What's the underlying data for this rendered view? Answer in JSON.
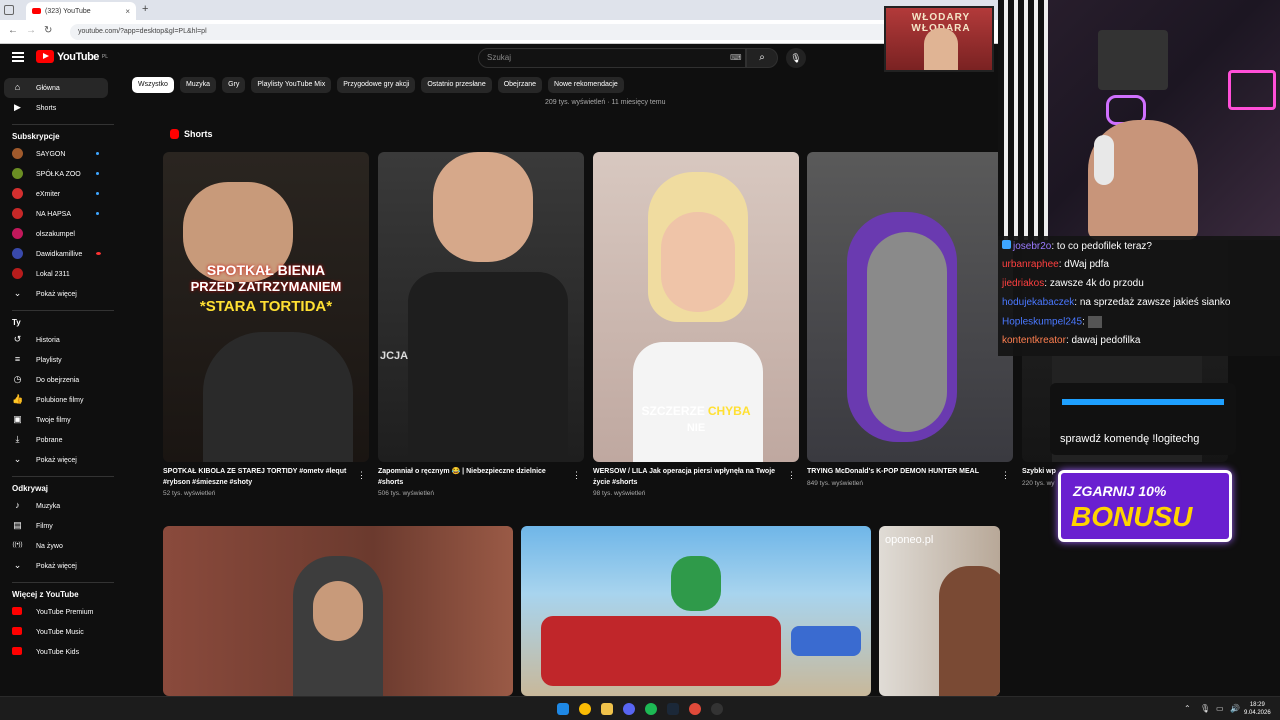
{
  "browser": {
    "tab_title": "(323) YouTube",
    "url": "youtube.com/?app=desktop&gl=PL&hl=pl",
    "new_tab": "+",
    "close": "×"
  },
  "youtube": {
    "logo_text": "YouTube",
    "logo_region": "PL",
    "search_placeholder": "Szukaj",
    "chips": [
      "Wszystko",
      "Muzyka",
      "Gry",
      "Playlisty YouTube Mix",
      "Przygodowe gry akcji",
      "Ostatnio przesłane",
      "Obejrzane",
      "Nowe rekomendacje"
    ],
    "views_line": "209 tys. wyświetleń · 11 miesięcy temu",
    "shorts_heading": "Shorts"
  },
  "sidebar": {
    "main": [
      {
        "label": "Główna",
        "icon": "home-icon"
      },
      {
        "label": "Shorts",
        "icon": "shorts-icon"
      }
    ],
    "subs_heading": "Subskrypcje",
    "subs": [
      {
        "label": "SAYGON",
        "color": "#a05a2c"
      },
      {
        "label": "SPÓŁKA ZOO",
        "color": "#6b8e23"
      },
      {
        "label": "eXmiter",
        "color": "#d32f2f"
      },
      {
        "label": "NA HAPSA",
        "color": "#c62828"
      },
      {
        "label": "olszakumpel",
        "color": "#c2185b"
      },
      {
        "label": "Dawidkamillive",
        "color": "#3949ab"
      },
      {
        "label": "Lokal 2311",
        "color": "#b71c1c"
      }
    ],
    "subs_live": "Live",
    "show_more": "Pokaż więcej",
    "you_heading": "Ty",
    "you": [
      {
        "label": "Historia",
        "icon": "history-icon"
      },
      {
        "label": "Playlisty",
        "icon": "playlist-icon"
      },
      {
        "label": "Do obejrzenia",
        "icon": "watch-later-icon"
      },
      {
        "label": "Polubione filmy",
        "icon": "like-icon"
      },
      {
        "label": "Twoje filmy",
        "icon": "your-videos-icon"
      },
      {
        "label": "Pobrane",
        "icon": "download-icon"
      },
      {
        "label": "Pokaż więcej",
        "icon": "chevron-down-icon"
      }
    ],
    "explore_heading": "Odkrywaj",
    "explore": [
      {
        "label": "Muzyka",
        "icon": "music-icon"
      },
      {
        "label": "Filmy",
        "icon": "film-icon"
      },
      {
        "label": "Na żywo",
        "icon": "live-icon"
      },
      {
        "label": "Pokaż więcej",
        "icon": "chevron-down-icon"
      }
    ],
    "more_heading": "Więcej z YouTube",
    "more": [
      {
        "label": "YouTube Premium"
      },
      {
        "label": "YouTube Music"
      },
      {
        "label": "YouTube Kids"
      }
    ]
  },
  "shorts": [
    {
      "title": "SPOTKAŁ KIBOLA ZE STAREJ TORTIDY #ometv #lequt #rybson #śmieszne #shoty",
      "views": "52 tys. wyświetleń",
      "overlay1": "SPOTKAŁ BIENIA",
      "overlay2": "PRZED ZATRZYMANIEM",
      "overlay3": "*STARA TORTIDA*"
    },
    {
      "title": "Zapomniał o ręcznym 😂 | Niebezpieczne dzielnice #shorts",
      "views": "506 tys. wyświetleń",
      "overlay1": "JCJA"
    },
    {
      "title": "WERSOW / LILA Jak operacja piersi wpłynęła na Twoje życie #shorts",
      "views": "98 tys. wyświetleń",
      "overlay1": "SZCZERZE",
      "overlay2": "CHYBA",
      "overlay3": "NIE"
    },
    {
      "title": "TRYING McDonald's K-POP DEMON HUNTER MEAL",
      "views": "849 tys. wyświetleń"
    },
    {
      "title": "Szybki wp",
      "views": "220 tys. wy"
    }
  ],
  "videos_row2": [
    {
      "overlay": ""
    },
    {
      "overlay": ""
    },
    {
      "overlay": "oponeo.pl"
    }
  ],
  "stream": {
    "banner": "WŁODARY WŁODARA",
    "chat": [
      {
        "user": "josebr2o",
        "text": "to co pedofilek teraz?",
        "color": "#9b7bff"
      },
      {
        "user": "urbanraphee",
        "text": "dWaj pdfa",
        "color": "#ff4040"
      },
      {
        "user": "jiedriakos",
        "text": "zawsze 4k do przodu",
        "color": "#ff4040"
      },
      {
        "user": "hodujekabaczek",
        "text": "na sprzedaż zawsze jakieś sianko",
        "color": "#4a78ff"
      },
      {
        "user": "Hopleskumpel245",
        "text": "",
        "color": "#4a78ff"
      },
      {
        "user": "kontentkreator",
        "text": "dawaj pedofilka",
        "color": "#ff7f50"
      }
    ],
    "command": "sprawdź komendę !logitechg",
    "bonus_line1": "ZGARNIJ 10%",
    "bonus_line2": "BONUSU"
  },
  "taskbar": {
    "time": "18:29",
    "date": "9.04.2026"
  }
}
